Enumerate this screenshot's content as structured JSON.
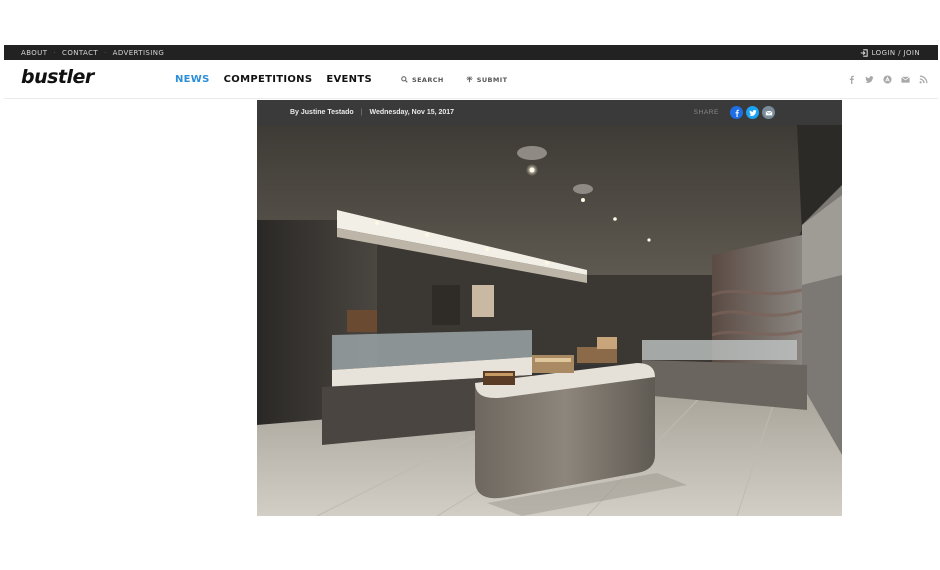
{
  "topbar": {
    "links": [
      "ABOUT",
      "CONTACT",
      "ADVERTISING"
    ],
    "login_label": "LOGIN / JOIN"
  },
  "header": {
    "logo": "bustler",
    "nav": [
      {
        "label": "NEWS",
        "active": true
      },
      {
        "label": "COMPETITIONS",
        "active": false
      },
      {
        "label": "EVENTS",
        "active": false
      }
    ],
    "search_label": "SEARCH",
    "submit_label": "SUBMIT",
    "social_icons": [
      "facebook-icon",
      "twitter-icon",
      "app-store-icon",
      "mail-icon",
      "rss-icon"
    ]
  },
  "article": {
    "author": "By Justine Testado",
    "date": "Wednesday, Nov 15, 2017",
    "share_label": "SHARE",
    "share_buttons": [
      {
        "icon": "facebook-icon",
        "color": "#1e6fe6"
      },
      {
        "icon": "twitter-icon",
        "color": "#1da1f2"
      },
      {
        "icon": "mail-icon",
        "color": "#7a8c99"
      }
    ],
    "image_alt": "Interior of a patisserie with a curved central display counter and illuminated glass cases"
  },
  "colors": {
    "accent": "#2d8fd8",
    "topbar_bg": "#222222",
    "meta_bg": "#3a3a3a"
  }
}
